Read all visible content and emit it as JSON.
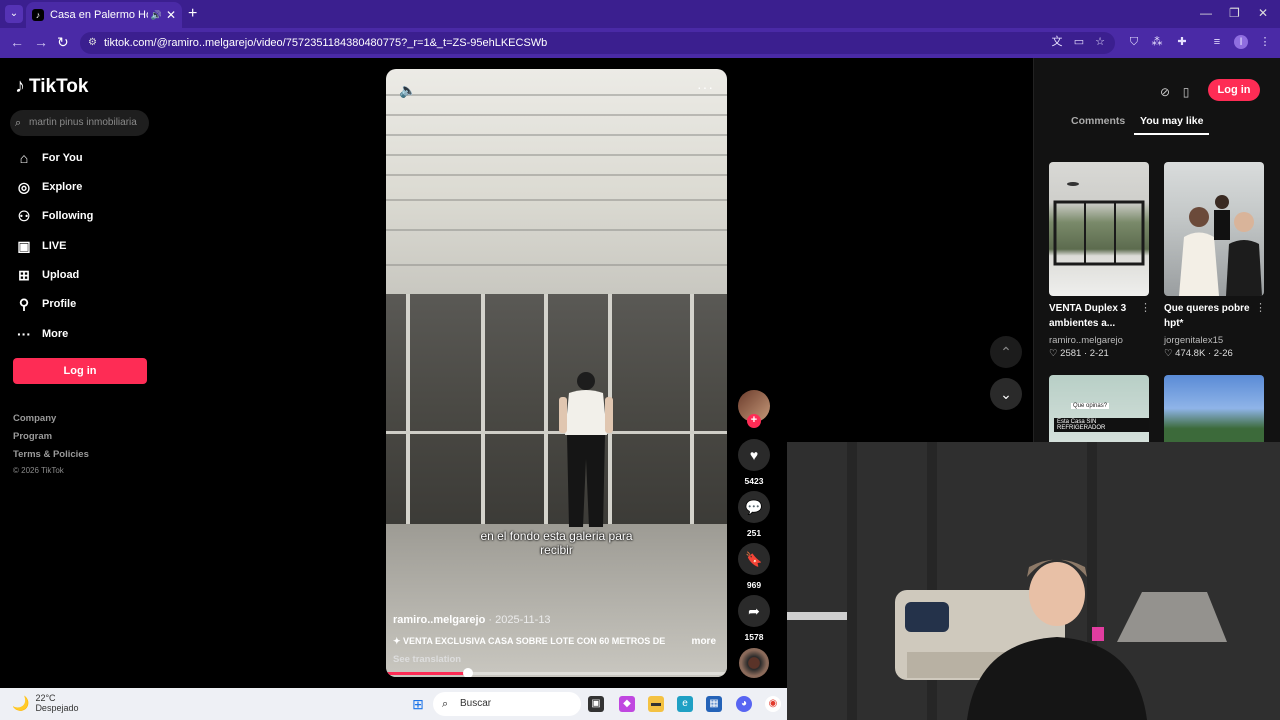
{
  "browser": {
    "tab_title": "Casa en Palermo Hollywood",
    "url": "tiktok.com/@ramiro..melgarejo/video/7572351184380480775?_r=1&_t=ZS-95ehLKECSWb"
  },
  "sidebar": {
    "brand": "TikTok",
    "search_placeholder": "martin pinus inmobiliaria",
    "nav": [
      {
        "label": "For You",
        "icon": "home-icon"
      },
      {
        "label": "Explore",
        "icon": "compass-icon"
      },
      {
        "label": "Following",
        "icon": "following-icon"
      },
      {
        "label": "LIVE",
        "icon": "live-icon"
      },
      {
        "label": "Upload",
        "icon": "upload-icon"
      },
      {
        "label": "Profile",
        "icon": "person-icon"
      },
      {
        "label": "More",
        "icon": "more-icon"
      }
    ],
    "login_label": "Log in",
    "footer": {
      "links": [
        "Company",
        "Program",
        "Terms & Policies"
      ],
      "copyright": "© 2026 TikTok"
    }
  },
  "video": {
    "subtitle_line1": "en el fondo esta galeria para",
    "subtitle_line2": "recibir",
    "author": "ramiro..melgarejo",
    "date": " · 2025-11-13",
    "description": "✦ VENTA EXCLUSIVA CASA SOBRE LOTE CON 60 METROS DE",
    "more_label": "more",
    "see_translation": "See translation",
    "progress_fraction": 0.24
  },
  "actions": {
    "likes": "5423",
    "comments": "251",
    "saves": "969",
    "shares": "1578"
  },
  "right_panel": {
    "login_label": "Log in",
    "tabs": [
      "Comments",
      "You may like"
    ],
    "active_tab": "You may like",
    "cards": [
      {
        "title": "VENTA Duplex 3 ambientes a...",
        "author": "ramiro..melgarejo",
        "likes": "2581",
        "date": "2-21"
      },
      {
        "title": "Que queres pobre hpt*",
        "author": "jorgenitalex15",
        "likes": "474.8K",
        "date": "2-26"
      }
    ],
    "card3_caption": "Esta Casa SIN REFRIGERADOR",
    "card3_overlay": "Que opinas?"
  },
  "taskbar": {
    "temperature": "22°C",
    "condition": "Despejado",
    "search_placeholder": "Buscar"
  },
  "colors": {
    "accent": "#fe2c55",
    "browser_chrome": "#3b1f8f"
  }
}
